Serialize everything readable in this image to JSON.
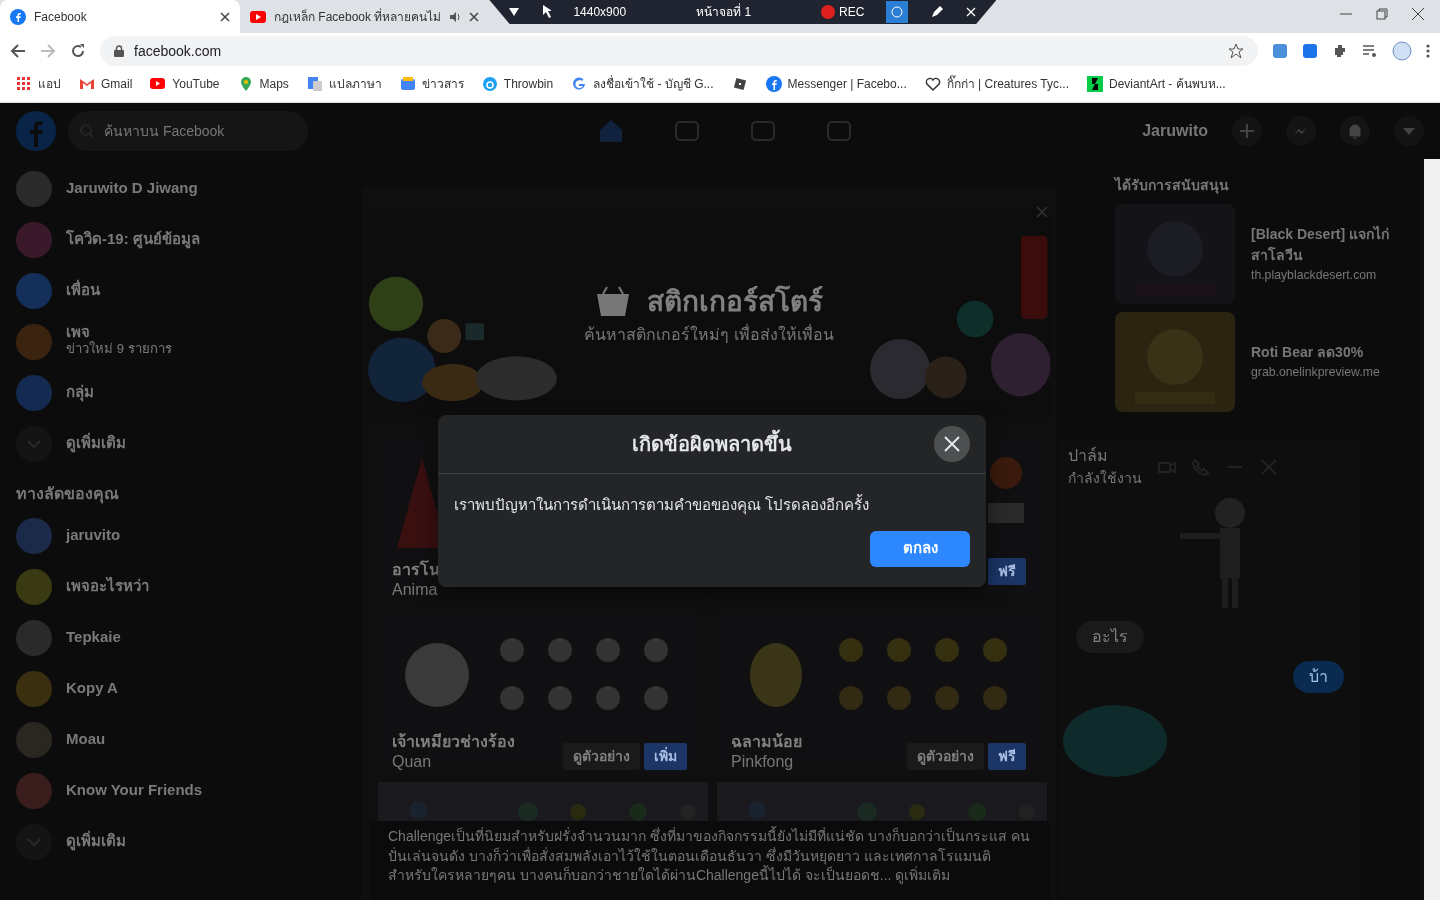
{
  "browser": {
    "tabs": [
      {
        "title": "Facebook",
        "kind": "facebook",
        "selected": true
      },
      {
        "title": "กฎเหล็ก Facebook ที่หลายคนไม่",
        "kind": "youtube",
        "selected": false
      }
    ],
    "recorder": {
      "resolution": "1440x900",
      "screen": "หน้าจอที่ 1",
      "record": "REC"
    },
    "address": "facebook.com",
    "bookmarks": [
      {
        "kind": "apps",
        "label": "แอป"
      },
      {
        "kind": "gmail",
        "label": "Gmail"
      },
      {
        "kind": "youtube",
        "label": "YouTube"
      },
      {
        "kind": "maps",
        "label": "Maps"
      },
      {
        "kind": "translate",
        "label": "แปลภาษา"
      },
      {
        "kind": "news",
        "label": "ข่าวสาร"
      },
      {
        "kind": "throwbin",
        "label": "Throwbin"
      },
      {
        "kind": "google",
        "label": "ลงชื่อเข้าใช้ - บัญชี G..."
      },
      {
        "kind": "roblox"
      },
      {
        "kind": "facebook",
        "label": "Messenger | Facebo..."
      },
      {
        "kind": "heart",
        "label": "กิ๊กก่า | Creatures Tyc..."
      },
      {
        "kind": "deviantart",
        "label": "DeviantArt - ค้นพบห..."
      }
    ]
  },
  "facebook": {
    "search": {
      "placeholder": "ค้นหาบน Facebook"
    },
    "user": "Jaruwito",
    "sidebar": [
      {
        "kind": "avatar",
        "label": "Jaruwito D Jiwang"
      },
      {
        "kind": "covid",
        "label": "โควิด-19: ศูนย์ข้อมูล"
      },
      {
        "kind": "friends",
        "label": "เพื่อน"
      },
      {
        "kind": "pages",
        "label": "เพจ",
        "sub": "ข่าวใหม่ 9 รายการ"
      },
      {
        "kind": "groups",
        "label": "กลุ่ม"
      },
      {
        "kind": "more",
        "label": "ดูเพิ่มเติม"
      }
    ],
    "shortcuts_title": "ทางลัดของคุณ",
    "shortcuts": [
      {
        "kind": "letter",
        "label": "jaruvito",
        "color": "#1c2a4a"
      },
      {
        "label": "เพจอะไรหว่า",
        "color": "#3a3a12"
      },
      {
        "label": "Tepkaie",
        "color": "#2a2a2a"
      },
      {
        "kind": "letter",
        "label": "Kopy A",
        "color": "#3a3010"
      },
      {
        "label": "Moau",
        "color": "#2a2620"
      },
      {
        "label": "Know Your Friends",
        "color": "#3a1e1e"
      },
      {
        "kind": "more",
        "label": "ดูเพิ่มเติม"
      }
    ],
    "sponsored": {
      "title": "ได้รับการสนับสนุน",
      "ads": [
        {
          "title": "[Black Desert] แจกไก่ สาโลวีน",
          "url": "th.playblackdesert.com"
        },
        {
          "title": "Roti Bear ลด30%",
          "url": "grab.onelinkpreview.me"
        }
      ]
    },
    "chat": {
      "name": "ปาล์ม",
      "status": "กำลังใช้งาน",
      "messages": [
        {
          "text": "อะไร",
          "mine": false
        },
        {
          "text": "บ้า",
          "mine": true
        }
      ]
    },
    "post_text": "Challengeเป็นที่นิยมสำหรับฝรั่งจำนวนมาก ซึ่งที่มาของกิจกรรมนี้ยังไม่มีที่แน่ชัด บางก็บอกว่าเป็นกระแส คนปั่นเล่นจนดัง บางก็ว่าเพื่อสั่งสมพลังเอาไว้ใช้ในตอนเดือนธันวา ซึ่งมีวันหยุดยาว และเทศกาลโรแมนติ สำหรับใครหลายๆคน บางคนก็บอกว่าชายใดได้ผ่านChallengeนี้ไปได้ จะเป็นยอดช...",
    "see_more": "ดูเพิ่มเติม"
  },
  "sticker_store": {
    "title": "สติกเกอร์สโตร์",
    "subtitle": "ค้นหาสติกเกอร์ใหม่ๆ เพื่อส่งให้เพื่อน",
    "packs": [
      {
        "name": "อารโน",
        "author": "Anima",
        "kind": "red"
      },
      {
        "action": "ฟรี",
        "kind": "badge"
      },
      {
        "name": "เจ้าเหมียวช่างร้อง",
        "author": "Quan",
        "preview": "ดูตัวอย่าง",
        "action": "เพิ่ม",
        "kind": "cat"
      },
      {
        "name": "ฉลามน้อย",
        "author": "Pinkfong",
        "preview": "ดูตัวอย่าง",
        "action": "ฟรี",
        "kind": "shark"
      }
    ]
  },
  "dialog": {
    "title": "เกิดข้อผิดพลาดขึ้น",
    "message": "เราพบปัญหาในการดำเนินการตามคำขอของคุณ โปรดลองอีกครั้ง",
    "button": "ตกลง"
  }
}
